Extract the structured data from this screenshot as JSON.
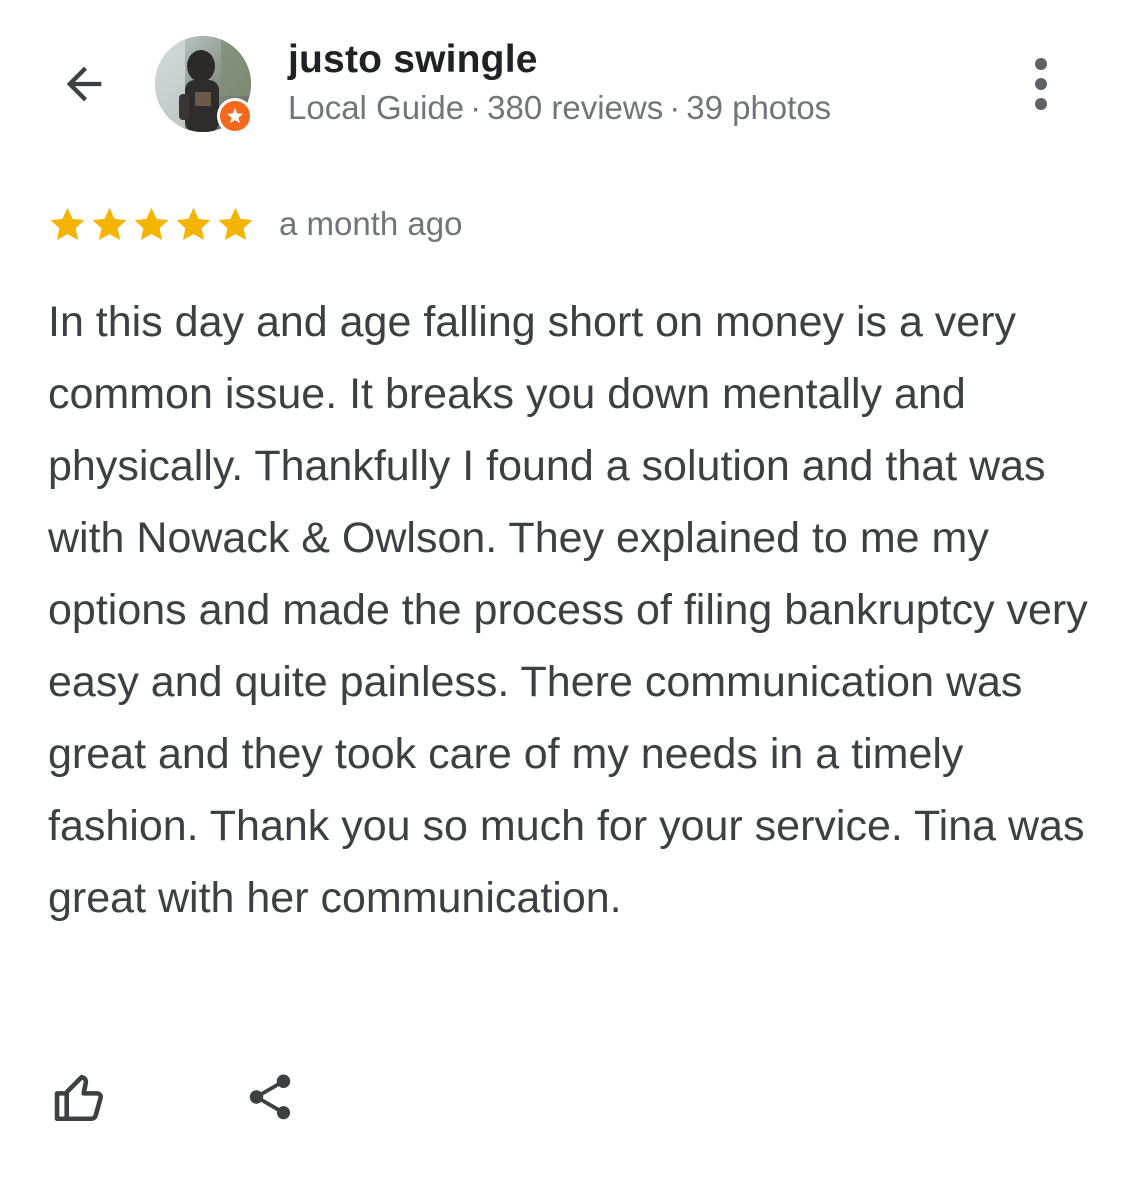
{
  "header": {
    "back_icon": "arrow-back-icon",
    "avatar_alt": "",
    "badge_icon": "local-guide-star-icon",
    "badge_color": "#f4691e",
    "user_name": "justo swingle",
    "meta": {
      "guide_label": "Local Guide",
      "reviews": "380 reviews",
      "photos": "39 photos",
      "separator": "·"
    },
    "more_icon": "more-vert-icon"
  },
  "review": {
    "rating": 5,
    "rating_max": 5,
    "star_color": "#f4b400",
    "date": "a month ago",
    "text": "In this day and age falling short on money is a very common issue. It breaks you down mentally and physically. Thankfully I found a solution and that was with Nowack & Owlson. They explained to me my options and made the process of filing bankruptcy very easy and quite painless. There communication was great and they took care of my needs in a timely fashion. Thank you so much for your service. Tina was great with her communication."
  },
  "actions": {
    "like_icon": "thumbs-up-icon",
    "share_icon": "share-icon"
  },
  "colors": {
    "title": "#202124",
    "secondary": "#70757a",
    "body": "#3c4043",
    "icon": "#3c4043"
  }
}
